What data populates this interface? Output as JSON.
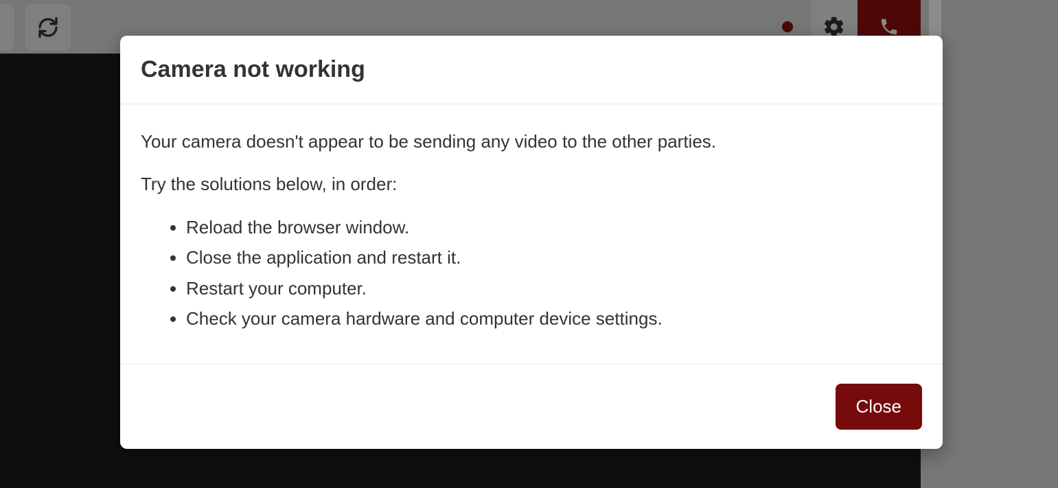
{
  "toolbar": {
    "refresh_icon": "refresh",
    "recording_indicator": true,
    "settings_icon": "gear",
    "hangup_icon": "phone"
  },
  "modal": {
    "title": "Camera not working",
    "intro": "Your camera doesn't appear to be sending any video to the other parties.",
    "subhead": "Try the solutions below, in order:",
    "steps": [
      "Reload the browser window.",
      "Close the application and restart it.",
      "Restart your computer.",
      "Check your camera hardware and computer device settings."
    ],
    "close_label": "Close"
  },
  "colors": {
    "accent_red": "#760b0b",
    "dark_bg": "#1c1c1c",
    "page_gray": "#d9d9d9"
  }
}
